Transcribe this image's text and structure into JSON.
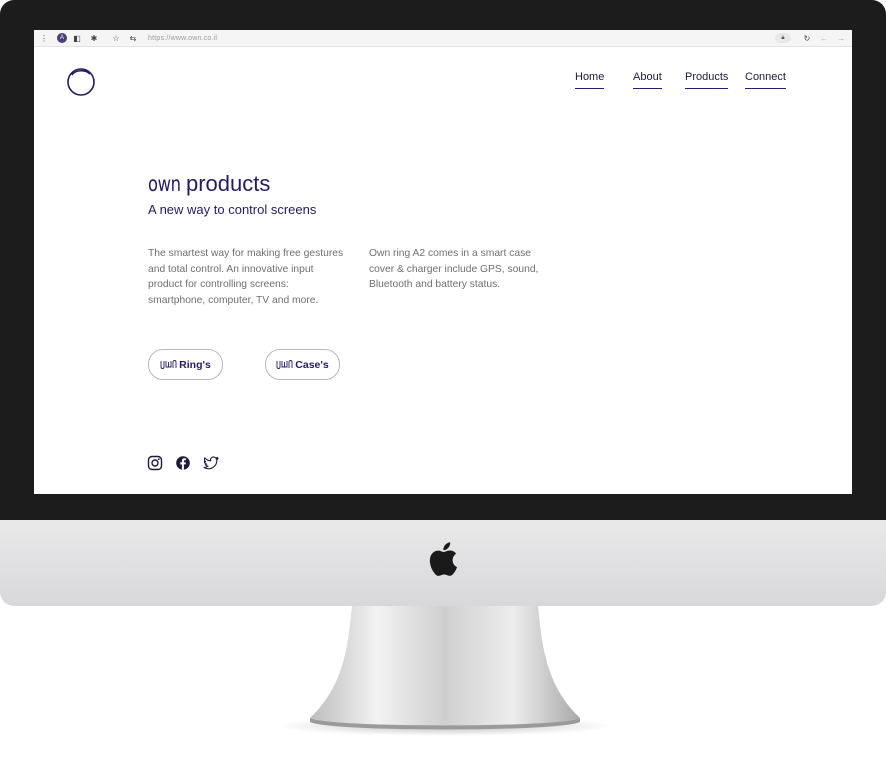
{
  "browser": {
    "avatar_letter": "A",
    "url": "https://www.own.co.il"
  },
  "nav": {
    "home": "Home",
    "about": "About",
    "products": "Products",
    "connect": "Connect"
  },
  "hero": {
    "brand": "own",
    "title": "products",
    "subtitle": "A new way to control screens",
    "paragraph_left": "The smartest way for making free gestures and total control. An innovative input product for controlling screens: smartphone, computer, TV and more.",
    "paragraph_right": "Own ring A2 comes in a smart case cover & charger include GPS, sound, Bluetooth and battery status."
  },
  "buttons": {
    "rings": "Ring's",
    "cases": "Case's"
  },
  "colors": {
    "brand": "#251b63",
    "bezel": "#1c1c1c"
  }
}
